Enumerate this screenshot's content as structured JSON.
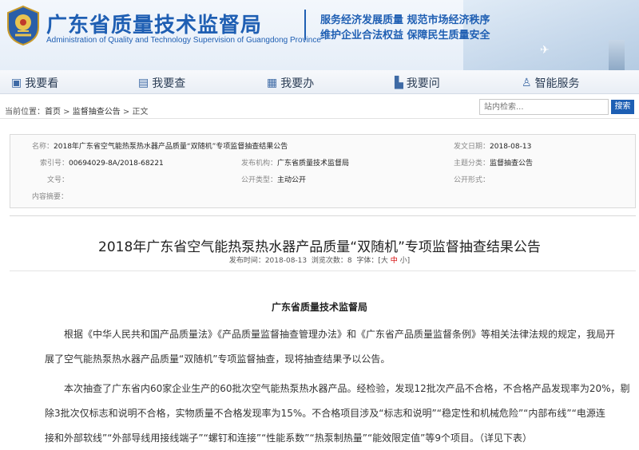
{
  "header": {
    "site_title": "广东省质量技术监督局",
    "site_title_en": "Administration of Quality and Technology Supervision of Guangdong Province",
    "slogan_line1": "服务经济发展质量  规范市场经济秩序",
    "slogan_line2": "维护企业合法权益  保障民生质量安全"
  },
  "nav": {
    "items": [
      {
        "label": "我要看"
      },
      {
        "label": "我要查"
      },
      {
        "label": "我要办"
      },
      {
        "label": "我要问"
      },
      {
        "label": "智能服务"
      }
    ]
  },
  "breadcrumb": {
    "prefix": "当前位置：",
    "home": "首页",
    "sep": " > ",
    "section": "监督抽查公告",
    "current": "正文"
  },
  "search": {
    "placeholder": "站内检索...",
    "button_label": "搜索"
  },
  "info": {
    "name_label": "名称：",
    "name_value": "2018年广东省空气能热泵热水器产品质量“双随机”专项监督抽查结果公告",
    "date_label": "发文日期：",
    "date_value": "2018-08-13",
    "index_label": "索引号：",
    "index_value": "00694029-8A/2018-68221",
    "agency_label": "发布机构：",
    "agency_value": "广东省质量技术监督局",
    "subject_label": "主题分类：",
    "subject_value": "监督抽查公告",
    "docno_label": "文号：",
    "docno_value": "",
    "publictype_label": "公开类型：",
    "publictype_value": "主动公开",
    "publicway_label": "公开形式：",
    "publicway_value": "",
    "summary_label": "内容摘要：",
    "summary_value": ""
  },
  "article": {
    "title": "2018年广东省空气能热泵热水器产品质量“双随机”专项监督抽查结果公告",
    "meta_pub_label": "发布时间：",
    "meta_pub_date": "2018-08-13",
    "meta_views_label": "浏览次数：",
    "meta_views": "8",
    "meta_font_label": "字体：[",
    "meta_font_big": "大",
    "meta_font_mid": "中",
    "meta_font_small": "小",
    "meta_font_end": "]",
    "org": "广东省质量技术监督局",
    "p1_line1": "根据《中华人民共和国产品质量法》《产品质量监督抽查管理办法》和《广东省产品质量监督条例》等相关法律法规的规定，我局开",
    "p1_line2": "展了空气能热泵热水器产品质量“双随机”专项监督抽查，现将抽查结果予以公告。",
    "p2_line1": "本次抽查了广东省内60家企业生产的60批次空气能热泵热水器产品。经检验，发现12批次产品不合格，不合格产品发现率为20%，剔",
    "p2_line2": "除3批次仅标志和说明不合格，实物质量不合格发现率为15%。不合格项目涉及“标志和说明”“稳定性和机械危险”“内部布线”“电源连",
    "p2_line3": "接和外部软线”“外部导线用接线端子”“螺钉和连接”“性能系数”“热泵制热量”“能效限定值”等9个项目。（详见下表）"
  }
}
